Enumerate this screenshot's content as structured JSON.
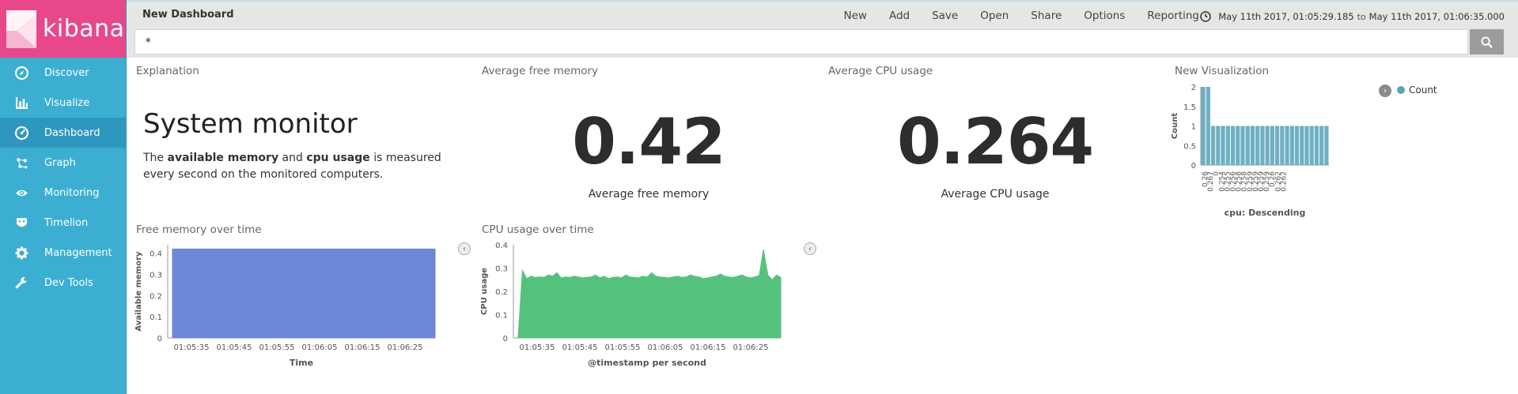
{
  "app": {
    "brand": "kibana",
    "accent_color": "#e8488b",
    "sidebar_color": "#3caed2"
  },
  "sidebar": {
    "items": [
      {
        "label": "Discover",
        "icon": "compass-icon"
      },
      {
        "label": "Visualize",
        "icon": "bar-chart-icon"
      },
      {
        "label": "Dashboard",
        "icon": "gauge-icon",
        "active": true
      },
      {
        "label": "Graph",
        "icon": "graph-icon"
      },
      {
        "label": "Monitoring",
        "icon": "eye-icon"
      },
      {
        "label": "Timelion",
        "icon": "timelion-icon"
      },
      {
        "label": "Management",
        "icon": "gear-icon"
      },
      {
        "label": "Dev Tools",
        "icon": "wrench-icon"
      }
    ]
  },
  "header": {
    "title": "New Dashboard",
    "menu": [
      "New",
      "Add",
      "Save",
      "Open",
      "Share",
      "Options",
      "Reporting"
    ],
    "time_from": "May 11th 2017, 01:05:29.185",
    "time_sep": "to",
    "time_to": "May 11th 2017, 01:06:35.000",
    "query": "*",
    "search_icon": "search-icon"
  },
  "panels": {
    "explanation": {
      "title": "Explanation",
      "heading": "System monitor",
      "text_pre": "The ",
      "bold1": "available memory",
      "text_mid": " and ",
      "bold2": "cpu usage",
      "text_post": " is measured every second on the monitored computers."
    },
    "avg_memory": {
      "title": "Average free memory",
      "value": "0.42",
      "label": "Average free memory"
    },
    "avg_cpu": {
      "title": "Average CPU usage",
      "value": "0.264",
      "label": "Average CPU usage"
    },
    "new_vis": {
      "title": "New Visualization",
      "legend": "Count",
      "xlabel": "cpu: Descending",
      "ylabel": "Count"
    },
    "free_memory": {
      "title": "Free memory over time",
      "xlabel": "Time",
      "ylabel": "Available memory"
    },
    "cpu_over_time": {
      "title": "CPU usage over time",
      "xlabel": "@timestamp per second",
      "ylabel": "CPU usage"
    }
  },
  "chart_data": [
    {
      "id": "new-visualization",
      "type": "bar",
      "categories": [
        "0.26",
        "0.267",
        "0",
        "0.254",
        "0.255",
        "0.256",
        "0.258",
        "0.258",
        "0.259",
        "0.259",
        "0.259",
        "0.259",
        "0.26",
        "0.262",
        "0.262"
      ],
      "values": [
        2,
        2,
        1,
        1,
        1,
        1,
        1,
        1,
        1,
        1,
        1,
        1,
        1,
        1,
        1,
        1,
        1,
        1,
        1,
        1,
        1,
        1,
        1,
        1,
        1,
        1
      ],
      "ylim": [
        0,
        2
      ],
      "yticks": [
        "2",
        "1.5",
        "1",
        "0.5",
        "0"
      ],
      "color": "#6fb0c2",
      "legend_position": "top-right"
    },
    {
      "id": "free-memory-over-time",
      "type": "area",
      "xticks": [
        "01:05:35",
        "01:05:45",
        "01:05:55",
        "01:06:05",
        "01:06:15",
        "01:06:25"
      ],
      "yticks": [
        "0.4",
        "0.3",
        "0.2",
        "0.1",
        "0"
      ],
      "ylim": [
        0,
        0.44
      ],
      "values": [
        0.42,
        0.42,
        0.42,
        0.42,
        0.42,
        0.42,
        0.42,
        0.42,
        0.42,
        0.42,
        0.42,
        0.42,
        0.42,
        0.42,
        0.42,
        0.42,
        0.42,
        0.42,
        0.42,
        0.42,
        0.42,
        0.42,
        0.42,
        0.42,
        0.42,
        0.42,
        0.42,
        0.42,
        0.42,
        0.42,
        0.42,
        0.42,
        0.42,
        0.42,
        0.42,
        0.42,
        0.42,
        0.42,
        0.42,
        0.42,
        0.42,
        0.42,
        0.42,
        0.42,
        0.42,
        0.42,
        0.42,
        0.42,
        0.42,
        0.42,
        0.42,
        0.42,
        0.42,
        0.42,
        0.42,
        0.42,
        0.42,
        0.42,
        0.42,
        0.42,
        0.42,
        0.42
      ],
      "color": "#6b87d8"
    },
    {
      "id": "cpu-usage-over-time",
      "type": "area",
      "xticks": [
        "01:05:35",
        "01:05:45",
        "01:05:55",
        "01:06:05",
        "01:06:15",
        "01:06:25"
      ],
      "yticks": [
        "0.4",
        "0.3",
        "0.2",
        "0.1",
        "0"
      ],
      "ylim": [
        0,
        0.4
      ],
      "values": [
        0,
        0.29,
        0.255,
        0.265,
        0.26,
        0.262,
        0.26,
        0.27,
        0.265,
        0.28,
        0.258,
        0.262,
        0.26,
        0.265,
        0.262,
        0.258,
        0.26,
        0.262,
        0.27,
        0.258,
        0.265,
        0.255,
        0.26,
        0.262,
        0.258,
        0.27,
        0.262,
        0.26,
        0.258,
        0.265,
        0.262,
        0.28,
        0.265,
        0.262,
        0.26,
        0.258,
        0.262,
        0.265,
        0.26,
        0.262,
        0.27,
        0.265,
        0.262,
        0.255,
        0.258,
        0.262,
        0.265,
        0.275,
        0.265,
        0.262,
        0.26,
        0.265,
        0.27,
        0.262,
        0.258,
        0.262,
        0.268,
        0.38,
        0.27,
        0.25,
        0.27,
        0.26
      ],
      "color": "#54c27d"
    }
  ]
}
